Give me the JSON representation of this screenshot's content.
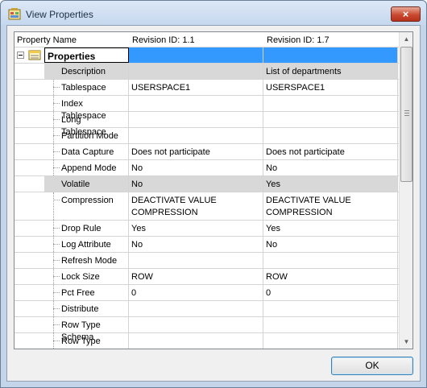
{
  "window": {
    "title": "View Properties",
    "close_glyph": "×",
    "icon": "properties-app-icon"
  },
  "grid": {
    "columns": [
      "Property Name",
      "Revision ID: 1.1",
      "Revision ID: 1.7"
    ],
    "group": {
      "label": "Properties",
      "expander_glyph": "−",
      "icon": "properties-group-icon"
    },
    "rows": [
      {
        "name": "Description",
        "rev1": "",
        "rev2": "List of departments",
        "shaded": true
      },
      {
        "name": "Tablespace",
        "rev1": "USERSPACE1",
        "rev2": "USERSPACE1",
        "shaded": false
      },
      {
        "name": "Index Tablespace",
        "rev1": "",
        "rev2": "",
        "shaded": false
      },
      {
        "name": "Long Tablespace",
        "rev1": "",
        "rev2": "",
        "shaded": false
      },
      {
        "name": "Partition Mode",
        "rev1": "",
        "rev2": "",
        "shaded": false
      },
      {
        "name": "Data Capture",
        "rev1": "Does not participate",
        "rev2": "Does not participate",
        "shaded": false
      },
      {
        "name": "Append Mode",
        "rev1": "No",
        "rev2": "No",
        "shaded": false
      },
      {
        "name": "Volatile",
        "rev1": "No",
        "rev2": "Yes",
        "shaded": true
      },
      {
        "name": "Compression",
        "rev1": "DEACTIVATE VALUE COMPRESSION",
        "rev2": "DEACTIVATE VALUE COMPRESSION",
        "shaded": false
      },
      {
        "name": "Drop Rule",
        "rev1": "Yes",
        "rev2": "Yes",
        "shaded": false
      },
      {
        "name": "Log Attribute",
        "rev1": "No",
        "rev2": "No",
        "shaded": false
      },
      {
        "name": "Refresh Mode",
        "rev1": "",
        "rev2": "",
        "shaded": false
      },
      {
        "name": "Lock Size",
        "rev1": "ROW",
        "rev2": "ROW",
        "shaded": false
      },
      {
        "name": "Pct Free",
        "rev1": "0",
        "rev2": "0",
        "shaded": false
      },
      {
        "name": "Distribute",
        "rev1": "",
        "rev2": "",
        "shaded": false
      },
      {
        "name": "Row Type Schema",
        "rev1": "",
        "rev2": "",
        "shaded": false
      },
      {
        "name": "Row Type Name",
        "rev1": "",
        "rev2": "",
        "shaded": false
      }
    ],
    "scrollbar": {
      "up_glyph": "▲",
      "down_glyph": "▼"
    },
    "colors": {
      "group_highlight": "#3399ff",
      "shaded_row": "#d8d8d8"
    }
  },
  "buttons": {
    "ok_label": "OK"
  }
}
